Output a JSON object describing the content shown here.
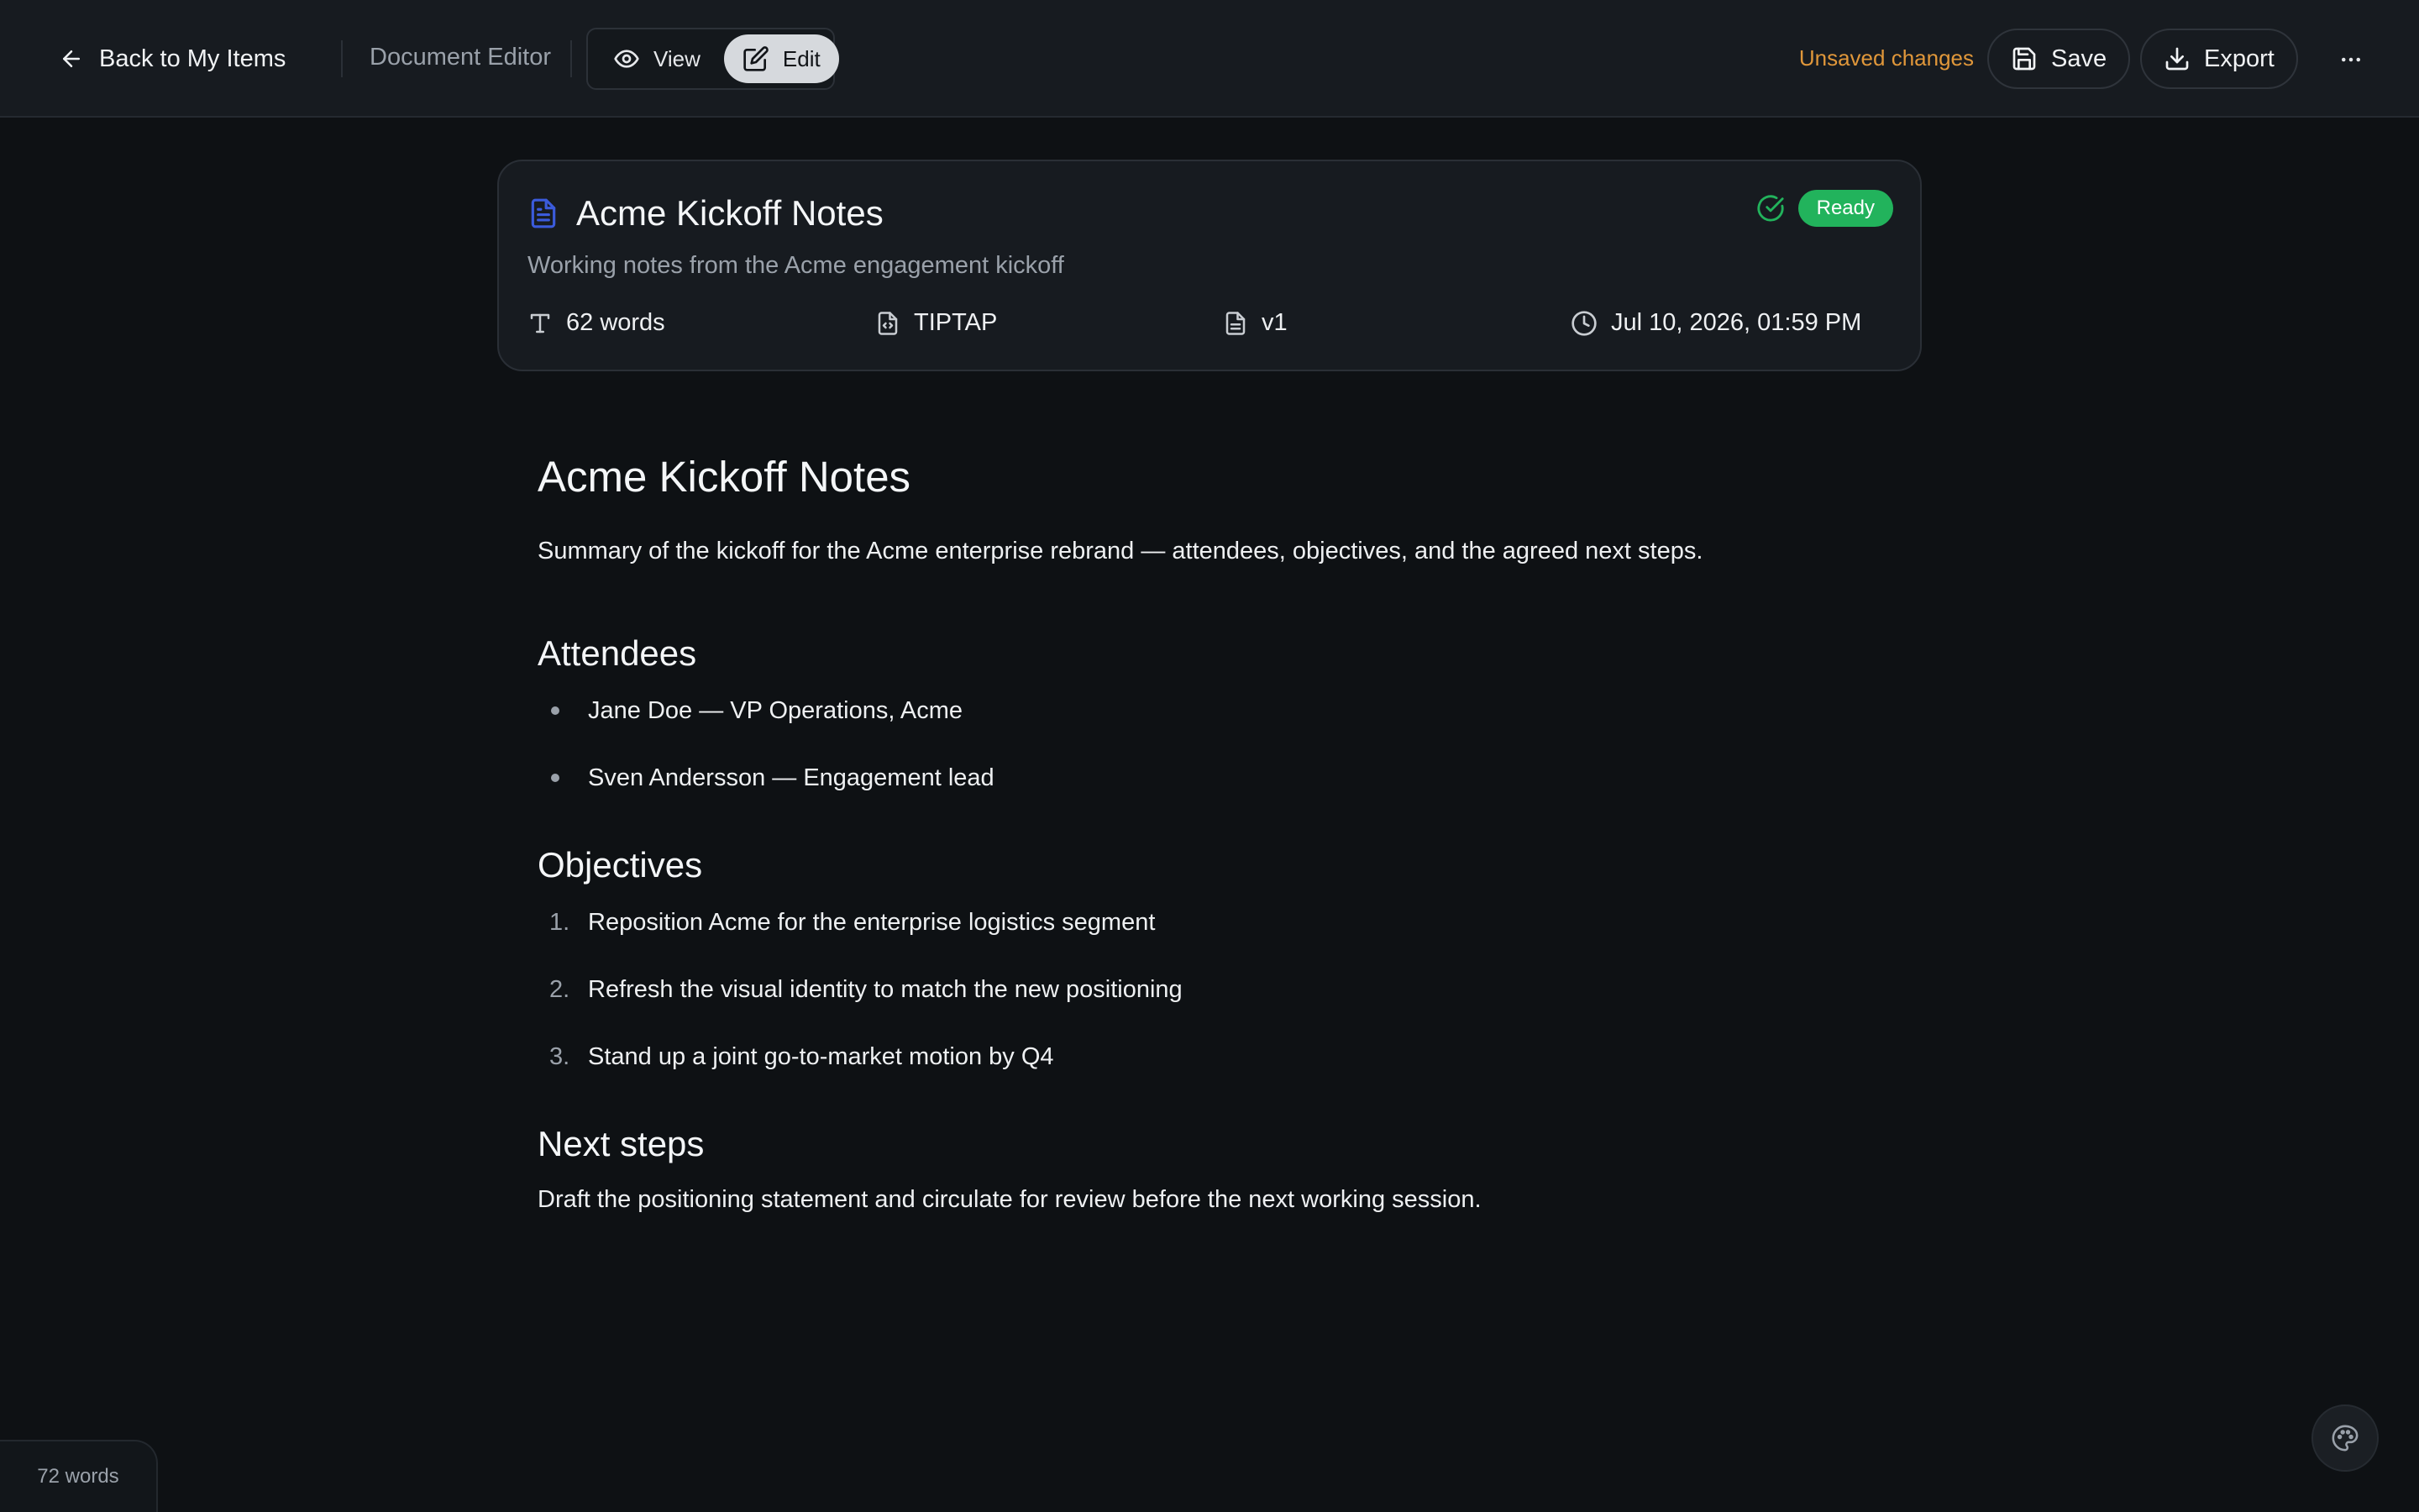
{
  "topbar": {
    "back_label": "Back to My Items",
    "section_label": "Document Editor",
    "view_label": "View",
    "edit_label": "Edit",
    "active_mode": "Edit",
    "unsaved_label": "Unsaved changes",
    "save_label": "Save",
    "export_label": "Export"
  },
  "card": {
    "title": "Acme Kickoff Notes",
    "subtitle": "Working notes from the Acme engagement kickoff",
    "status": "Ready",
    "word_count": "62 words",
    "format": "TIPTAP",
    "version": "v1",
    "updated": "Jul 10, 2026, 01:59 PM"
  },
  "document": {
    "heading": "Acme Kickoff Notes",
    "intro": "Summary of the kickoff for the Acme enterprise rebrand — attendees, objectives, and the agreed next steps.",
    "attendees_heading": "Attendees",
    "attendees": [
      "Jane Doe — VP Operations, Acme",
      "Sven Andersson — Engagement lead"
    ],
    "objectives_heading": "Objectives",
    "objectives": [
      {
        "num": "1.",
        "text": "Reposition Acme for the enterprise logistics segment"
      },
      {
        "num": "2.",
        "text": "Refresh the visual identity to match the new positioning"
      },
      {
        "num": "3.",
        "text": "Stand up a joint go-to-market motion by Q4"
      }
    ],
    "next_steps_heading": "Next steps",
    "next_steps": "Draft the positioning statement and circulate for review before the next working session."
  },
  "footer": {
    "word_count": "72 words"
  },
  "colors": {
    "background": "#0e1114",
    "topbar": "#171b20",
    "accent_unsaved": "#e0973a",
    "status_ready": "#22b35c",
    "doc_icon": "#3b5bdb"
  },
  "icons": {
    "back": "arrow-left-icon",
    "view": "eye-icon",
    "edit": "pencil-square-icon",
    "save": "floppy-disk-icon",
    "export": "download-icon",
    "more": "more-horizontal-icon",
    "doc": "file-text-icon",
    "status": "check-circle-icon",
    "words": "text-type-icon",
    "format": "file-code-icon",
    "version": "file-icon",
    "updated": "clock-icon",
    "palette": "palette-icon"
  }
}
